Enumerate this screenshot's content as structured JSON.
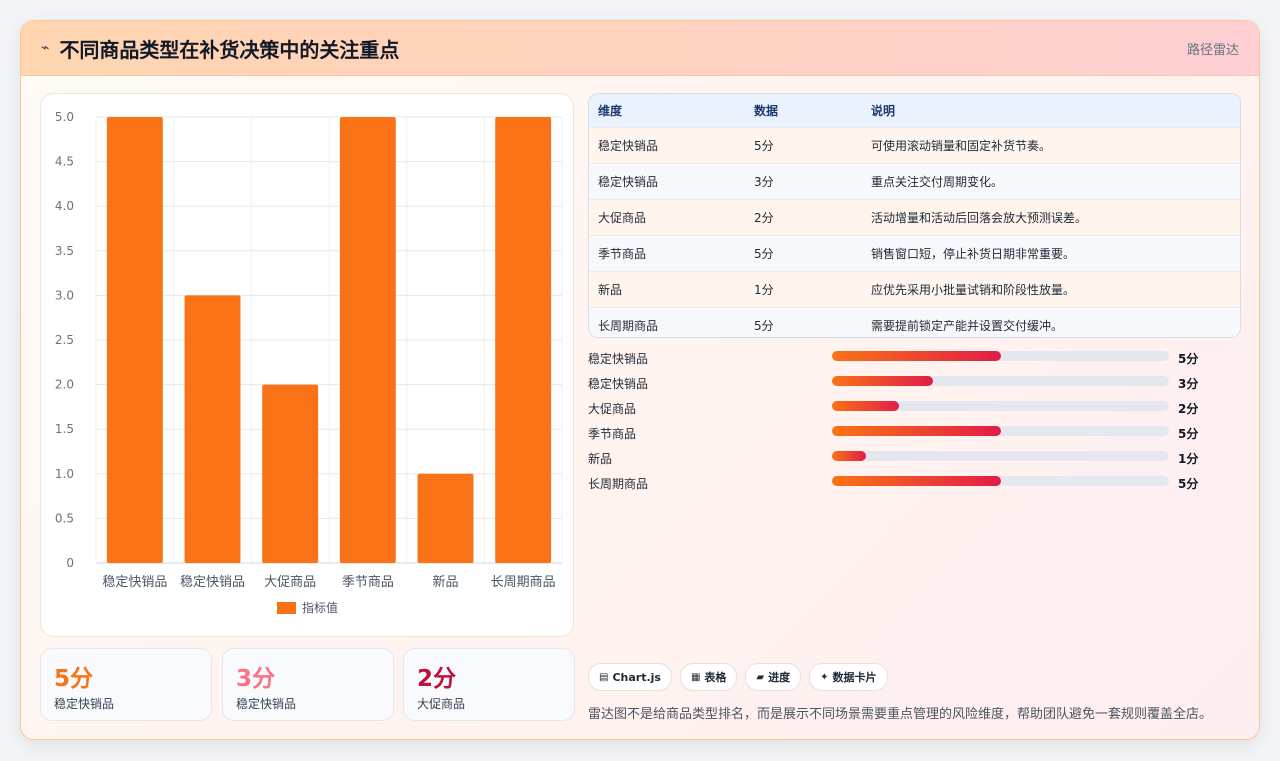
{
  "header": {
    "icon": "lightning-icon",
    "icon_glyph": "⌁",
    "title": "不同商品类型在补货决策中的关注重点",
    "right_label": "路径雷达"
  },
  "chart_data": {
    "type": "bar",
    "categories": [
      "稳定快销品",
      "稳定快销品",
      "大促商品",
      "季节商品",
      "新品",
      "长周期商品"
    ],
    "series": [
      {
        "name": "指标值",
        "values": [
          5,
          3,
          2,
          5,
          1,
          5
        ],
        "color": "#f97316"
      }
    ],
    "ylim": [
      0,
      5
    ],
    "yticks": [
      "0",
      "0.5",
      "1.0",
      "1.5",
      "2.0",
      "2.5",
      "3.0",
      "3.5",
      "4.0",
      "4.5",
      "5.0"
    ],
    "grid": true,
    "legend": "bottom"
  },
  "table": {
    "headers": [
      "维度",
      "数据",
      "说明"
    ],
    "rows": [
      [
        "稳定快销品",
        "5分",
        "可使用滚动销量和固定补货节奏。"
      ],
      [
        "稳定快销品",
        "3分",
        "重点关注交付周期变化。"
      ],
      [
        "大促商品",
        "2分",
        "活动增量和活动后回落会放大预测误差。"
      ],
      [
        "季节商品",
        "5分",
        "销售窗口短，停止补货日期非常重要。"
      ],
      [
        "新品",
        "1分",
        "应优先采用小批量试销和阶段性放量。"
      ],
      [
        "长周期商品",
        "5分",
        "需要提前锁定产能并设置交付缓冲。"
      ]
    ]
  },
  "progress": {
    "max": 10,
    "items": [
      {
        "label": "稳定快销品",
        "value": 5,
        "text": "5分"
      },
      {
        "label": "稳定快销品",
        "value": 3,
        "text": "3分"
      },
      {
        "label": "大促商品",
        "value": 2,
        "text": "2分"
      },
      {
        "label": "季节商品",
        "value": 5,
        "text": "5分"
      },
      {
        "label": "新品",
        "value": 1,
        "text": "1分"
      },
      {
        "label": "长周期商品",
        "value": 5,
        "text": "5分"
      }
    ]
  },
  "stats": [
    {
      "value": "5分",
      "label": "稳定快销品",
      "color": "#f97316"
    },
    {
      "value": "3分",
      "label": "稳定快销品",
      "color": "#fb7185"
    },
    {
      "value": "2分",
      "label": "大促商品",
      "color": "#be123c"
    }
  ],
  "chips": [
    {
      "icon": "chart-icon",
      "glyph": "▤",
      "label": "Chart.js"
    },
    {
      "icon": "table-icon",
      "glyph": "▦",
      "label": "表格"
    },
    {
      "icon": "progress-icon",
      "glyph": "▰",
      "label": "进度"
    },
    {
      "icon": "sparkle-icon",
      "glyph": "✦",
      "label": "数据卡片"
    }
  ],
  "footnote": "雷达图不是给商品类型排名，而是展示不同场景需要重点管理的风险维度，帮助团队避免一套规则覆盖全店。"
}
